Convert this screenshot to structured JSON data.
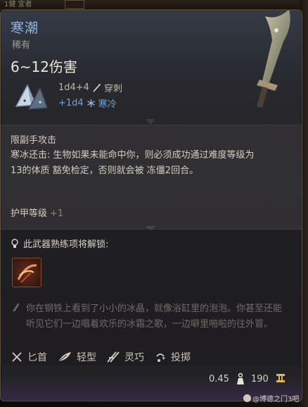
{
  "background": {
    "topbar_label": "1健 宜者"
  },
  "item": {
    "name": "寒潮",
    "rarity": "稀有",
    "damage_range": "6~12伤害",
    "damage_dice": "1d4+4",
    "damage_type": "穿刺",
    "bonus_dice": "+1d4",
    "bonus_type": "寒冷",
    "accent_color": "#8fb7e8",
    "cold_color": "#6fa4e0"
  },
  "properties": {
    "melee": "限副手攻击",
    "effect_text": "寒冰还击: 生物如果未能命中你，则必须成功通过难度等级为13的体质 豁免检定，否则就会被 冻僵2回合。",
    "armor_label": "护甲等级",
    "armor_bonus": "+1"
  },
  "unlock": {
    "header": "此武器熟练项将解锁:",
    "ability_icon": "frost-slash-icon"
  },
  "flavor": "你在钢铁上看到了小小的冰晶，就像浴缸里的泡泡。你甚至还能听见它们一边唱着欢乐的冰霜之歌，一边噼里啪啦的往外冒。",
  "tags": [
    {
      "label": "匕首",
      "icon": "dagger-icon"
    },
    {
      "label": "轻型",
      "icon": "feather-icon"
    },
    {
      "label": "灵巧",
      "icon": "finesse-icon"
    },
    {
      "label": "投掷",
      "icon": "throw-icon"
    }
  ],
  "footer": {
    "weight": "0.45",
    "price": "190"
  },
  "watermark": "@博德之门3吧"
}
